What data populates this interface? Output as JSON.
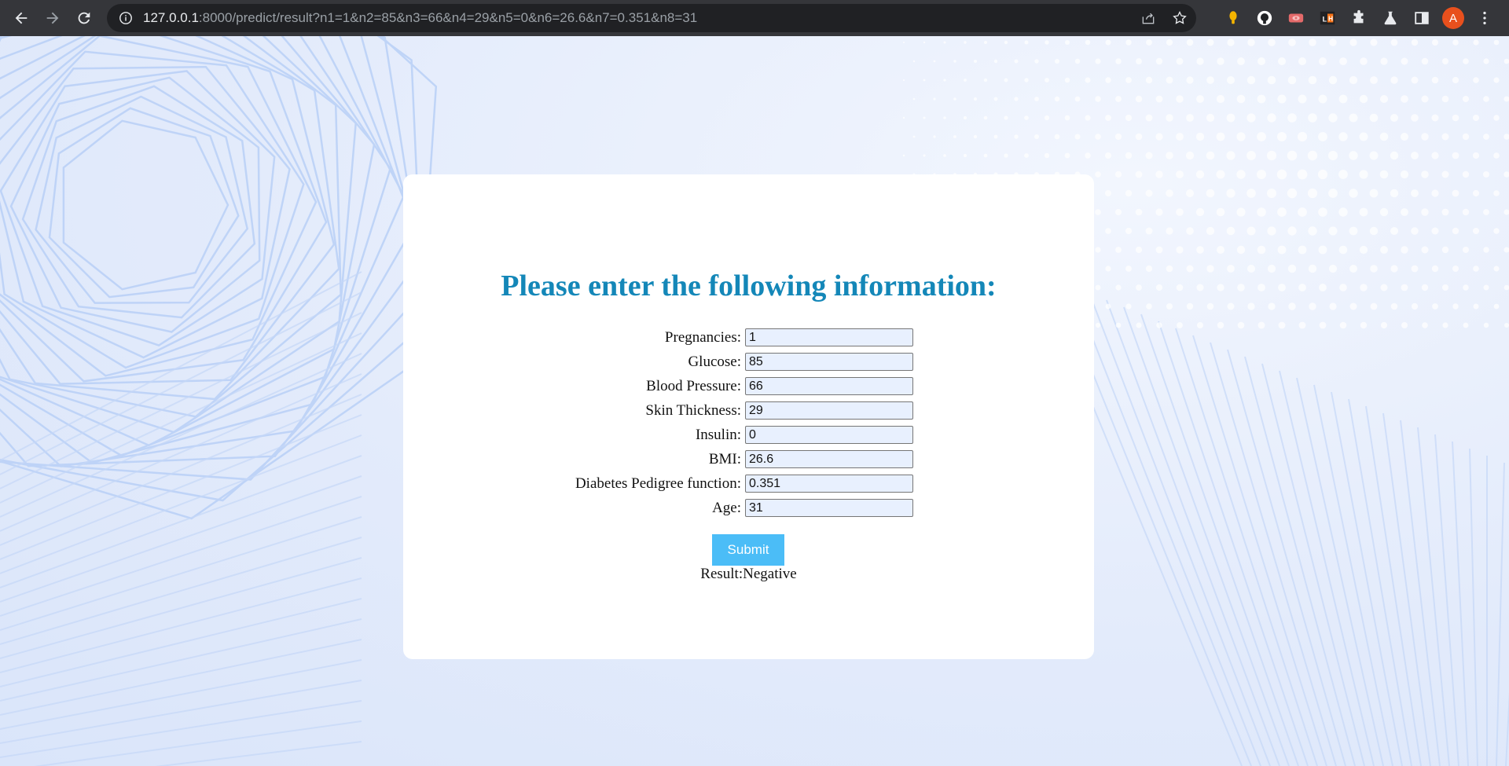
{
  "browser": {
    "url_host": "127.0.0.1",
    "url_rest": ":8000/predict/result?n1=1&n2=85&n3=66&n4=29&n5=0&n6=26.6&n7=0.351&n8=31",
    "profile_initial": "A",
    "icons": [
      "back-icon",
      "forward-icon",
      "reload-icon",
      "info-icon",
      "share-icon",
      "star-icon",
      "lightbulb-extension-icon",
      "github-extension-icon",
      "eye-extension-icon",
      "lighthouse-extension-icon",
      "puzzle-icon",
      "flask-icon",
      "sidebar-icon",
      "more-icon"
    ]
  },
  "form": {
    "title": "Please enter the following information:",
    "fields": [
      {
        "label": "Pregnancies:",
        "value": "1"
      },
      {
        "label": "Glucose:",
        "value": "85"
      },
      {
        "label": "Blood Pressure:",
        "value": "66"
      },
      {
        "label": "Skin Thickness:",
        "value": "29"
      },
      {
        "label": "Insulin:",
        "value": "0"
      },
      {
        "label": "BMI:",
        "value": "26.6"
      },
      {
        "label": "Diabetes Pedigree function:",
        "value": "0.351"
      },
      {
        "label": "Age:",
        "value": "31"
      }
    ],
    "submit_label": "Submit",
    "result_text": "Result:Negative"
  },
  "colors": {
    "heading": "#1487b8",
    "submit": "#4bbdf7",
    "input_bg": "#e8f0fe",
    "chrome": "#35363a"
  }
}
